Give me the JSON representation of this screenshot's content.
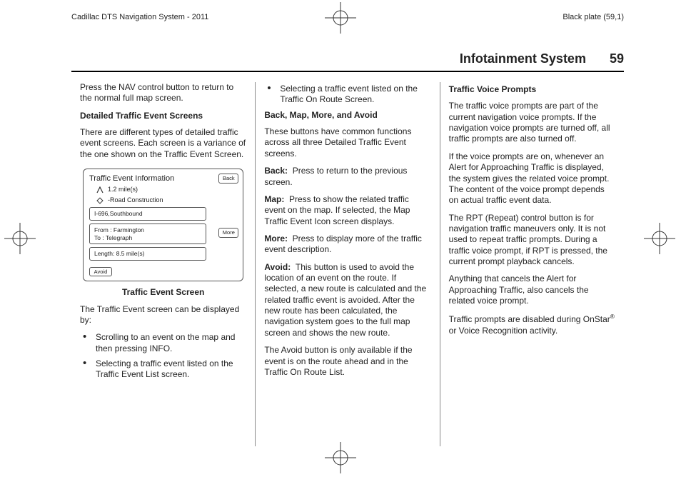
{
  "meta": {
    "doc_title": "Cadillac DTS Navigation System - 2011",
    "plate": "Black plate (59,1)"
  },
  "header": {
    "section": "Infotainment System",
    "page": "59"
  },
  "col1": {
    "p1": "Press the NAV control button to return to the normal full map screen.",
    "h1": "Detailed Traffic Event Screens",
    "p2": "There are different types of detailed traffic event screens. Each screen is a variance of the one shown on the Traffic Event Screen.",
    "figure": {
      "title": "Traffic Event Information",
      "dist": "1.2 mile(s)",
      "constr": "-Road Construction",
      "route": "I-696,Southbound",
      "from": "From : Farmington",
      "to": "To     : Telegraph",
      "len": "Length: 8.5 mile(s)",
      "back": "Back",
      "more": "More",
      "avoid": "Avoid"
    },
    "cap": "Traffic Event Screen",
    "p3": "The Traffic Event screen can be displayed by:",
    "b1": "Scrolling to an event on the map and then pressing INFO.",
    "b2": "Selecting a traffic event listed on the Traffic Event List screen."
  },
  "col2": {
    "b1": "Selecting a traffic event listed on the Traffic On Route Screen.",
    "h1": "Back, Map, More, and Avoid",
    "p1": "These buttons have common functions across all three Detailed Traffic Event screens.",
    "back_l": "Back:",
    "back_t": "Press to return to the previous screen.",
    "map_l": "Map:",
    "map_t": "Press to show the related traffic event on the map. If selected, the Map Traffic Event Icon screen displays.",
    "more_l": "More:",
    "more_t": "Press to display more of the traffic event description.",
    "avoid_l": "Avoid:",
    "avoid_t": "This button is used to avoid the location of an event on the route. If selected, a new route is calculated and the related traffic event is avoided. After the new route has been calculated, the navigation system goes to the full map screen and shows the new route.",
    "p2": "The Avoid button is only available if the event is on the route ahead and in the Traffic On Route List."
  },
  "col3": {
    "h1": "Traffic Voice Prompts",
    "p1": "The traffic voice prompts are part of the current navigation voice prompts. If the navigation voice prompts are turned off, all traffic prompts are also turned off.",
    "p2": "If the voice prompts are on, whenever an Alert for Approaching Traffic is displayed, the system gives the related voice prompt. The content of the voice prompt depends on actual traffic event data.",
    "p3": "The RPT (Repeat) control button is for navigation traffic maneuvers only. It is not used to repeat traffic prompts. During a traffic voice prompt, if RPT is pressed, the current prompt playback cancels.",
    "p4": "Anything that cancels the Alert for Approaching Traffic, also cancels the related voice prompt.",
    "p5a": "Traffic prompts are disabled during OnStar",
    "p5b": " or Voice Recognition activity."
  }
}
